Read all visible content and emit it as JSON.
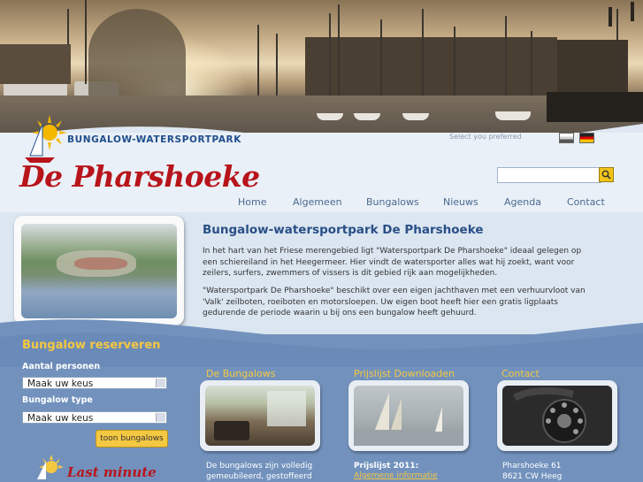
{
  "logo": {
    "subtitle": "BUNGALOW-WATERSPORTPARK",
    "name": "De Pharshoeke"
  },
  "language": {
    "label": "Select you preferred",
    "flags": [
      "flag-uk-icon",
      "flag-germany-icon"
    ]
  },
  "search": {
    "placeholder": "",
    "button_icon": "search-icon"
  },
  "nav": {
    "items": [
      "Home",
      "Algemeen",
      "Bungalows",
      "Nieuws",
      "Agenda",
      "Contact"
    ]
  },
  "main": {
    "title": "Bungalow-watersportpark De Pharshoeke",
    "paragraph1": "In het hart van het Friese merengebied ligt \"Watersportpark De Pharshoeke\" ideaal gelegen op een schiereiland in het Heegermeer. Hier vindt de watersporter alles wat hij zoekt, want voor zeilers, surfers, zwemmers of vissers is dit gebied rijk aan mogelijkheden.",
    "paragraph2": "\"Watersportpark De Pharshoeke\" beschikt over een eigen jachthaven met een verhuurvloot van 'Valk' zeilboten, roeiboten en motorsloepen. Uw eigen boot heeft hier een gratis ligplaats gedurende de periode waarin u bij ons een bungalow heeft gehuurd."
  },
  "reservation": {
    "title": "Bungalow reserveren",
    "persons_label": "Aantal personen",
    "persons_value": "Maak uw keus",
    "type_label": "Bungalow type",
    "type_value": "Maak uw keus",
    "button": "toon bungalows",
    "lastminute": "Last minute"
  },
  "columns": [
    {
      "title": "De Bungalows",
      "text": "De bungalows zijn volledig gemeubileerd, gestoffeerd",
      "link": ""
    },
    {
      "title": "Prijslijst Downloaden",
      "text": "Prijslijst 2011:",
      "link": "Algemene informatie"
    },
    {
      "title": "Contact",
      "text": "Pharshoeke 61",
      "text2": "8621 CW Heeg",
      "link": ""
    }
  ],
  "colors": {
    "accent": "#f5c842",
    "brand_red": "#b8141b",
    "nav_blue": "#4a6a8f",
    "title_blue": "#2a4f86"
  }
}
